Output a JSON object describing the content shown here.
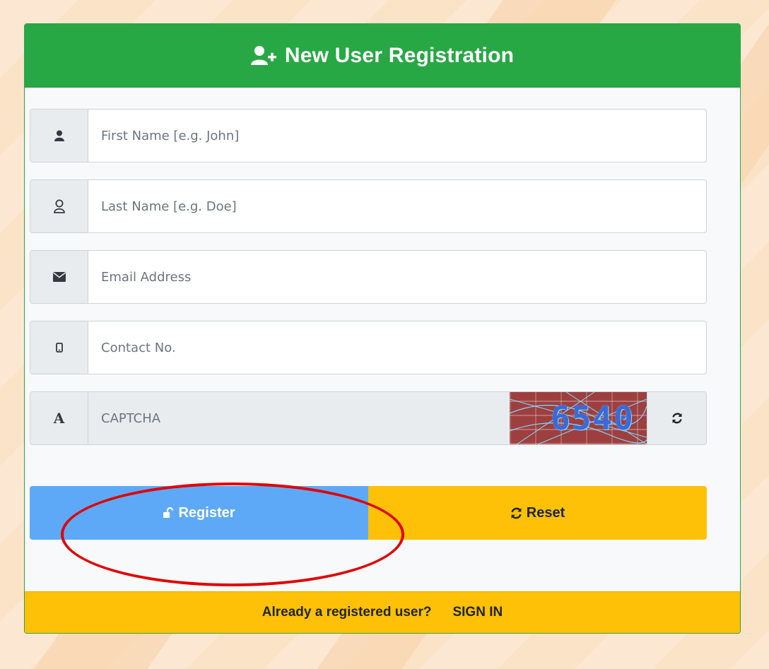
{
  "header": {
    "title": "New User Registration",
    "icon": "user-plus-icon"
  },
  "form": {
    "first_name": {
      "placeholder": "First Name [e.g. John]",
      "value": "",
      "icon": "user-solid-icon"
    },
    "last_name": {
      "placeholder": "Last Name [e.g. Doe]",
      "value": "",
      "icon": "user-outline-icon"
    },
    "email": {
      "placeholder": "Email Address",
      "value": "",
      "icon": "envelope-icon"
    },
    "contact": {
      "placeholder": "Contact No.",
      "value": "",
      "icon": "mobile-icon"
    },
    "captcha": {
      "placeholder": "CAPTCHA",
      "value": "",
      "icon": "font-a-icon",
      "code": "6540",
      "refresh_icon": "refresh-icon"
    }
  },
  "buttons": {
    "register_label": "Register",
    "register_icon": "unlock-icon",
    "reset_label": "Reset",
    "reset_icon": "refresh-icon"
  },
  "footer": {
    "prompt": "Already a registered user?",
    "signin_label": "SIGN IN"
  },
  "colors": {
    "header_green": "#28a745",
    "register_blue": "#5ea9f7",
    "reset_yellow": "#ffc107",
    "annotation_red": "#e00000",
    "background": "#fbe3c8"
  }
}
